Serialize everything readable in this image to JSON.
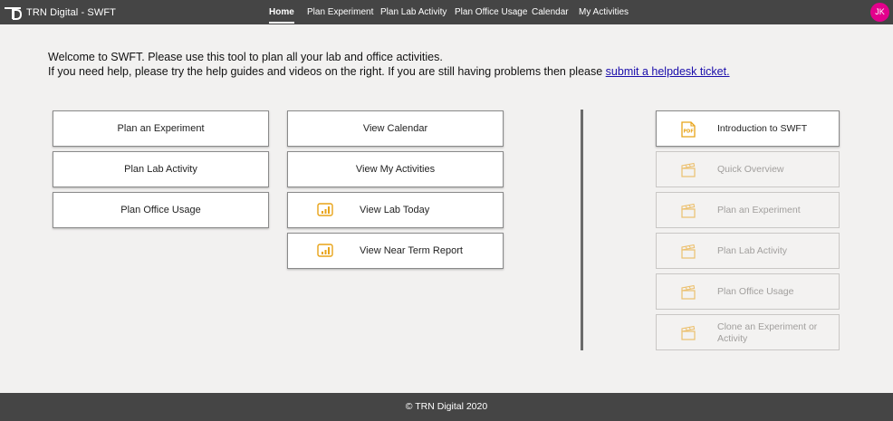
{
  "brand": {
    "title": "TRN Digital - SWFT"
  },
  "nav": {
    "items": [
      {
        "label": "Home",
        "active": true
      },
      {
        "label": "Plan Experiment"
      },
      {
        "label": "Plan Lab Activity"
      },
      {
        "label": "Plan Office Usage"
      },
      {
        "label": "Calendar"
      },
      {
        "label": "My Activities"
      }
    ]
  },
  "user": {
    "initials": "JK",
    "avatar_color": "#e3008c"
  },
  "intro": {
    "line1": "Welcome to SWFT. Please use this tool to plan all your lab and office activities.",
    "line2": "If you need help, please try the help guides and videos on the right. If you are still having problems then please ",
    "link": "submit a helpdesk ticket."
  },
  "tiles": {
    "col1": [
      "Plan an Experiment",
      "Plan Lab Activity",
      "Plan Office Usage"
    ],
    "col2": [
      {
        "label": "View Calendar",
        "icon": ""
      },
      {
        "label": "View My Activities",
        "icon": ""
      },
      {
        "label": "View Lab Today",
        "icon": "report-chart-icon"
      },
      {
        "label": "View Near Term Report",
        "icon": "report-chart-icon"
      }
    ]
  },
  "help": {
    "items": [
      {
        "label": "Introduction to SWFT",
        "icon": "pdf-icon",
        "enabled": true
      },
      {
        "label": "Quick Overview",
        "icon": "clapperboard-icon",
        "enabled": false
      },
      {
        "label": "Plan an Experiment",
        "icon": "clapperboard-icon",
        "enabled": false
      },
      {
        "label": "Plan Lab Activity",
        "icon": "clapperboard-icon",
        "enabled": false
      },
      {
        "label": "Plan Office Usage",
        "icon": "clapperboard-icon",
        "enabled": false
      },
      {
        "label": "Clone an Experiment or Activity",
        "icon": "clapperboard-icon",
        "enabled": false
      }
    ]
  },
  "footer": {
    "text": "© TRN Digital 2020"
  },
  "colors": {
    "topbar": "#454545",
    "background": "#f2f1f0",
    "icon_gold": "#e8a317",
    "link": "#1a0dab",
    "avatar": "#e3008c"
  }
}
